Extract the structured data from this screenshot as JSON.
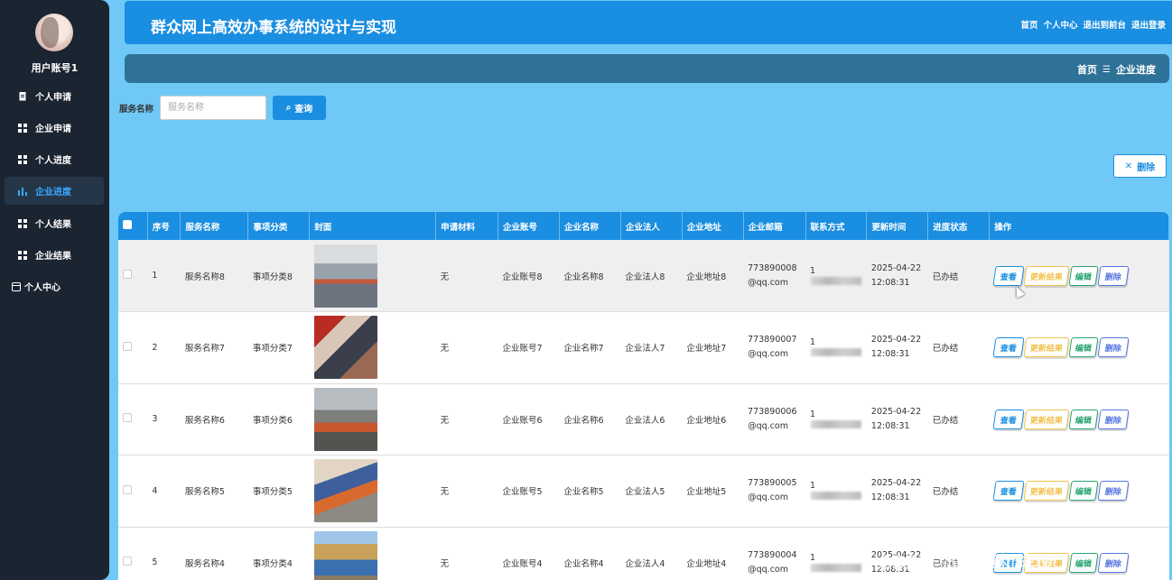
{
  "sidebar": {
    "username": "用户账号1",
    "items": [
      {
        "label": "个人申请",
        "icon": "document-icon"
      },
      {
        "label": "企业申请",
        "icon": "grid-icon"
      },
      {
        "label": "个人进度",
        "icon": "grid-icon"
      },
      {
        "label": "企业进度",
        "icon": "bar-chart-icon",
        "active": true
      },
      {
        "label": "个人结果",
        "icon": "grid-icon"
      },
      {
        "label": "企业结果",
        "icon": "grid-icon"
      },
      {
        "label": "个人中心",
        "icon": "card-icon"
      }
    ]
  },
  "header": {
    "title": "群众网上高效办事系统的设计与实现",
    "links": [
      "首页",
      "个人中心",
      "退出到前台",
      "退出登录"
    ]
  },
  "breadcrumb": {
    "home": "首页",
    "separator": "☰",
    "current": "企业进度"
  },
  "search": {
    "label": "服务名称",
    "placeholder": "服务名称",
    "button": "查询"
  },
  "toolbar": {
    "delete_label": "删除"
  },
  "table": {
    "headers": [
      "序号",
      "服务名称",
      "事项分类",
      "封面",
      "申请材料",
      "企业账号",
      "企业名称",
      "企业法人",
      "企业地址",
      "企业邮箱",
      "联系方式",
      "更新时间",
      "进度状态",
      "操作"
    ],
    "actions": {
      "view": "查看",
      "update": "更新结果",
      "edit": "编辑",
      "delete": "删除"
    },
    "rows": [
      {
        "no": "1",
        "service": "服务名称8",
        "category": "事项分类8",
        "material": "无",
        "account": "企业账号8",
        "name": "企业名称8",
        "legal": "企业法人8",
        "address": "企业地址8",
        "email": "773890008@qq.com",
        "phone": "1",
        "time": "2025-04-22 12:08:31",
        "status": "已办结"
      },
      {
        "no": "2",
        "service": "服务名称7",
        "category": "事项分类7",
        "material": "无",
        "account": "企业账号7",
        "name": "企业名称7",
        "legal": "企业法人7",
        "address": "企业地址7",
        "email": "773890007@qq.com",
        "phone": "1",
        "time": "2025-04-22 12:08:31",
        "status": "已办结"
      },
      {
        "no": "3",
        "service": "服务名称6",
        "category": "事项分类6",
        "material": "无",
        "account": "企业账号6",
        "name": "企业名称6",
        "legal": "企业法人6",
        "address": "企业地址6",
        "email": "773890006@qq.com",
        "phone": "1",
        "time": "2025-04-22 12:08:31",
        "status": "已办结"
      },
      {
        "no": "4",
        "service": "服务名称5",
        "category": "事项分类5",
        "material": "无",
        "account": "企业账号5",
        "name": "企业名称5",
        "legal": "企业法人5",
        "address": "企业地址5",
        "email": "773890005@qq.com",
        "phone": "1",
        "time": "2025-04-22 12:08:31",
        "status": "已办结"
      },
      {
        "no": "5",
        "service": "服务名称4",
        "category": "事项分类4",
        "material": "无",
        "account": "企业账号4",
        "name": "企业名称4",
        "legal": "企业法人4",
        "address": "企业地址4",
        "email": "773890004@qq.com",
        "phone": "1",
        "time": "2025-04-22 12:08:31",
        "status": "已办结"
      }
    ]
  },
  "watermark": "CSDN @计算机毕设",
  "colors": {
    "primary": "#1a8ee1",
    "sidebar": "#1b2431",
    "page_bg": "#70c8f7",
    "warning": "#f0c24d",
    "success": "#27a46e",
    "danger": "#5575e0"
  }
}
